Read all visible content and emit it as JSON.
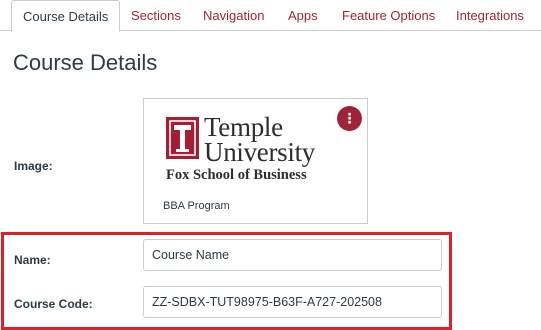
{
  "tabs": [
    {
      "label": "Course Details",
      "active": true
    },
    {
      "label": "Sections"
    },
    {
      "label": "Navigation"
    },
    {
      "label": "Apps"
    },
    {
      "label": "Feature Options"
    },
    {
      "label": "Integrations"
    }
  ],
  "page_title": "Course Details",
  "image": {
    "label": "Image:",
    "logo_name_line1": "Temple",
    "logo_name_line2": "University",
    "logo_subtitle": "Fox School of Business",
    "caption": "BBA Program",
    "menu_icon": "kebab-vertical-icon"
  },
  "fields": {
    "name_label": "Name:",
    "name_value": "Course Name",
    "code_label": "Course Code:",
    "code_value": "ZZ-SDBX-TUT98975-B63F-A727-202508"
  },
  "colors": {
    "accent": "#9e2537",
    "highlight_border": "#d7232a",
    "text": "#2d3b45",
    "border": "#c7cdd1"
  }
}
